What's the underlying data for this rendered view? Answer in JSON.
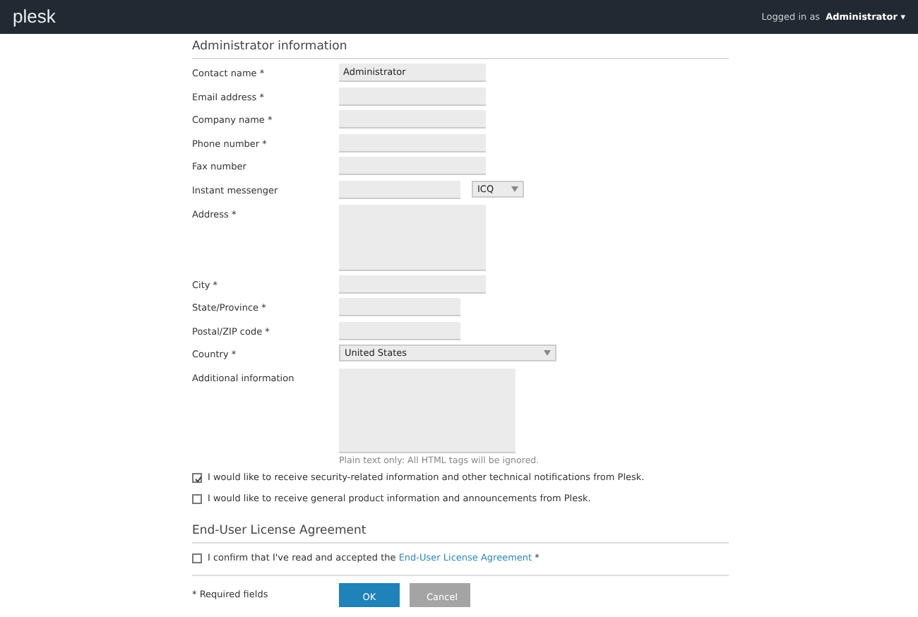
{
  "header": {
    "logo": "plesk",
    "logged_in_label": "Logged in as",
    "user": "Administrator",
    "user_caret": "▾"
  },
  "admin_section": {
    "title": "Administrator information",
    "fields": [
      {
        "kind": "text",
        "label": "Contact name *",
        "value": "Administrator"
      },
      {
        "kind": "text",
        "label": "Email address *"
      },
      {
        "kind": "text",
        "label": "Company name *"
      },
      {
        "kind": "text",
        "label": "Phone number *"
      },
      {
        "kind": "text",
        "label": "Fax number"
      },
      {
        "kind": "im",
        "label": "Instant messenger",
        "select_value": "ICQ"
      },
      {
        "kind": "textarea",
        "label": "Address *"
      },
      {
        "kind": "text",
        "label": "City *"
      },
      {
        "kind": "short",
        "label": "State/Province *"
      },
      {
        "kind": "short",
        "label": "Postal/ZIP code *"
      },
      {
        "kind": "select",
        "label": "Country *",
        "value": "United States"
      },
      {
        "kind": "bigtextarea",
        "label": "Additional information",
        "hint": "Plain text only: All HTML tags will be ignored."
      }
    ],
    "checkboxes": [
      {
        "label": "I would like to receive security-related information and other technical notifications from Plesk.",
        "checked": true
      },
      {
        "label": "I would like to receive general product information and announcements from Plesk.",
        "checked": false
      }
    ]
  },
  "eula_section": {
    "title": "End-User License Agreement",
    "checkbox": {
      "checked": false,
      "text_before": "I confirm that I've read and accepted the",
      "link": "End-User License Agreement",
      "text_after": "*"
    }
  },
  "footer": {
    "required_note": "* Required fields",
    "buttons": [
      {
        "kind": "primary",
        "label": "OK"
      },
      {
        "kind": "secondary",
        "label": "Cancel"
      }
    ]
  }
}
